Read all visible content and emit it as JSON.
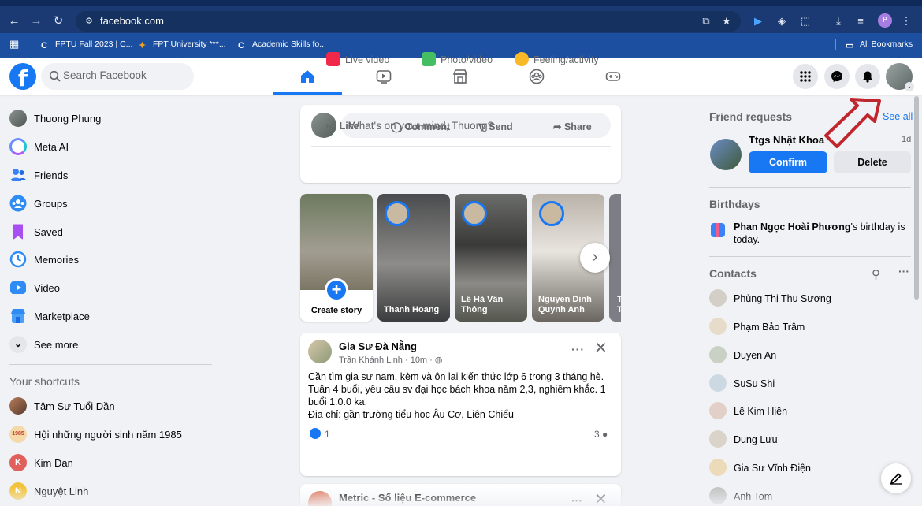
{
  "browser": {
    "url": "facebook.com",
    "profile_initial": "P",
    "bookmarks": [
      {
        "label": "FPTU Fall 2023 | C...",
        "icon": "c-icon"
      },
      {
        "label": "FPT University ***...",
        "icon": "fpt-icon"
      },
      {
        "label": "Academic Skills fo...",
        "icon": "c-icon"
      }
    ],
    "all_bookmarks": "All Bookmarks"
  },
  "header": {
    "logo": "f",
    "search_placeholder": "Search Facebook",
    "tabs": [
      "home",
      "video",
      "marketplace",
      "groups",
      "gaming"
    ],
    "active_tab": "home",
    "accent": "#1877f2"
  },
  "left_nav": {
    "items": [
      {
        "label": "Thuong Phung",
        "icon": "profile-avatar"
      },
      {
        "label": "Meta AI",
        "icon": "meta-ai-icon"
      },
      {
        "label": "Friends",
        "icon": "friends-icon"
      },
      {
        "label": "Groups",
        "icon": "groups-icon"
      },
      {
        "label": "Saved",
        "icon": "saved-icon"
      },
      {
        "label": "Memories",
        "icon": "memories-icon"
      },
      {
        "label": "Video",
        "icon": "video-icon"
      },
      {
        "label": "Marketplace",
        "icon": "marketplace-icon"
      },
      {
        "label": "See more",
        "icon": "chevron-down-icon"
      }
    ],
    "shortcuts_title": "Your shortcuts",
    "shortcuts": [
      {
        "label": "Tâm Sự Tuổi Dần"
      },
      {
        "label": "Hội những người sinh năm 1985",
        "badge": "1985"
      },
      {
        "label": "Kim Đan",
        "initial": "K"
      },
      {
        "label": "Nguyệt Linh",
        "initial": "N"
      }
    ]
  },
  "composer": {
    "placeholder": "What's on your mind, Thuong?",
    "actions": [
      "Live video",
      "Photo/video",
      "Feeling/activity"
    ]
  },
  "stories": {
    "create_label": "Create story",
    "items": [
      {
        "name": "Thanh Hoang"
      },
      {
        "name": "Lê Hà Vân Thông"
      },
      {
        "name": "Nguyen Dinh Quynh Anh"
      },
      {
        "name": "T T"
      }
    ]
  },
  "post": {
    "author": "Gia Sư Đà Nẵng",
    "subtitle": "Trần Khánh Linh · 10m · ",
    "text": "Cần tìm gia sư nam, kèm và ôn lại kiến thức lớp 6 trong 3 tháng hè. Tuần 4 buổi, yêu cầu sv đại học bách khoa năm 2,3, nghiêm khắc. 1 buổi 1.0.0 ka.",
    "address": "Địa chỉ: gần trường tiểu học Âu Cơ, Liên Chiểu",
    "likes": "1",
    "comments": "3",
    "actions": [
      "Like",
      "Comment",
      "Send",
      "Share"
    ]
  },
  "post2": {
    "author": "Metric - Số liệu E-commerce"
  },
  "right": {
    "friend_requests_title": "Friend requests",
    "see_all": "See all",
    "request": {
      "name": "Ttgs Nhật Khoa",
      "time": "1d",
      "confirm": "Confirm",
      "delete": "Delete"
    },
    "birthdays_title": "Birthdays",
    "birthday_name": "Phan Ngọc Hoài Phương",
    "birthday_suffix": "'s birthday is today.",
    "contacts_title": "Contacts",
    "contacts": [
      "Phùng Thị Thu Sương",
      "Phạm Bảo Trâm",
      "Duyen An",
      "SuSu Shi",
      "Lê Kim Hiền",
      "Dung Lưu",
      "Gia Sư Vĩnh Điện",
      "Anh Tom"
    ]
  },
  "annotation": {
    "color": "#c0262d"
  }
}
